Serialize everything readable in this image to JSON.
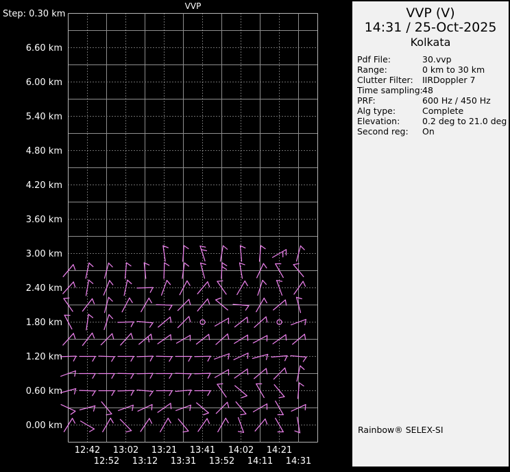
{
  "plot": {
    "title": "VVP",
    "step_label": "Step: 0.30 km"
  },
  "panel": {
    "title": "VVP (V)",
    "datetime": "14:31 / 25-Oct-2025",
    "site": "Kolkata",
    "fields": [
      {
        "label": "Pdf File:",
        "value": "30.vvp"
      },
      {
        "label": "Range:",
        "value": "0 km to 30 km"
      },
      {
        "label": "Clutter Filter:",
        "value": "IIRDoppler 7"
      },
      {
        "label": "Time sampling:",
        "value": "48"
      },
      {
        "label": "PRF:",
        "value": "600 Hz / 450 Hz"
      },
      {
        "label": "Alg type:",
        "value": "Complete"
      },
      {
        "label": "Elevation:",
        "value": "0.2 deg to 21.0 deg"
      },
      {
        "label": "Second reg:",
        "value": "On"
      }
    ],
    "branding": "Rainbow® SELEX-SI"
  },
  "chart_data": {
    "type": "wind-barb-time-height",
    "title": "VVP",
    "step_km": 0.3,
    "height_range_km": [
      0.0,
      7.2
    ],
    "grid": "solid-and-dotted-alternating",
    "y_tick_labels": [
      "6.60 km",
      "6.00 km",
      "5.40 km",
      "4.80 km",
      "4.20 km",
      "3.60 km",
      "3.00 km",
      "2.40 km",
      "1.80 km",
      "1.20 km",
      "0.60 km",
      "0.00 km"
    ],
    "y_tick_values_km": [
      6.6,
      6.0,
      5.4,
      4.8,
      4.2,
      3.6,
      3.0,
      2.4,
      1.8,
      1.2,
      0.6,
      0.0
    ],
    "x_tick_labels": [
      "12:42",
      "12:52",
      "13:02",
      "13:12",
      "13:21",
      "13:31",
      "13:41",
      "13:52",
      "14:02",
      "14:11",
      "14:21",
      "14:31"
    ],
    "x_label_stagger": "odd-ticks-upper-row,even-ticks-lower-row",
    "columns": 13,
    "labeled_ticks_start_col": 1,
    "colors": {
      "background": "#000000",
      "barb": "#ee82ee",
      "grid_solid": "#8f8f8f",
      "grid_dotted": "#dcdcdc",
      "frame": "#b8b8b8",
      "text": "#ffffff",
      "panel_bg": "#f1f1f1",
      "panel_text": "#000000"
    },
    "calm_points": [
      {
        "height_km": 1.8,
        "col": 7
      },
      {
        "height_km": 1.8,
        "col": 11
      }
    ],
    "barbs_format": [
      "height_km",
      "col",
      "staff_angle_deg_cw_from_up",
      "feathers"
    ],
    "barbs": [
      [
        3.0,
        5,
        -8,
        1
      ],
      [
        3.0,
        6,
        4,
        1
      ],
      [
        3.0,
        7,
        -18,
        2
      ],
      [
        3.0,
        8,
        10,
        1
      ],
      [
        3.0,
        9,
        -5,
        1
      ],
      [
        3.0,
        10,
        5,
        1
      ],
      [
        3.0,
        11,
        60,
        2
      ],
      [
        3.0,
        12,
        15,
        1
      ],
      [
        2.7,
        0,
        40,
        1
      ],
      [
        2.7,
        1,
        12,
        1
      ],
      [
        2.7,
        2,
        15,
        1
      ],
      [
        2.7,
        3,
        5,
        1
      ],
      [
        2.7,
        4,
        -6,
        1
      ],
      [
        2.7,
        5,
        2,
        1
      ],
      [
        2.7,
        6,
        8,
        1
      ],
      [
        2.7,
        7,
        -15,
        1
      ],
      [
        2.7,
        8,
        3,
        2
      ],
      [
        2.7,
        9,
        -10,
        1
      ],
      [
        2.7,
        10,
        25,
        1
      ],
      [
        2.7,
        11,
        -30,
        1
      ],
      [
        2.7,
        12,
        -40,
        1
      ],
      [
        2.4,
        0,
        42,
        1
      ],
      [
        2.4,
        1,
        10,
        1
      ],
      [
        2.4,
        2,
        22,
        1
      ],
      [
        2.4,
        3,
        12,
        1
      ],
      [
        2.4,
        4,
        88,
        1
      ],
      [
        2.4,
        5,
        20,
        1
      ],
      [
        2.4,
        6,
        28,
        1
      ],
      [
        2.4,
        7,
        40,
        1
      ],
      [
        2.4,
        8,
        -35,
        1
      ],
      [
        2.4,
        9,
        30,
        1
      ],
      [
        2.4,
        10,
        18,
        1
      ],
      [
        2.4,
        11,
        -20,
        1
      ],
      [
        2.4,
        12,
        35,
        1
      ],
      [
        2.1,
        0,
        -35,
        1
      ],
      [
        2.1,
        1,
        38,
        1
      ],
      [
        2.1,
        2,
        15,
        1
      ],
      [
        2.1,
        3,
        28,
        1
      ],
      [
        2.1,
        4,
        30,
        1
      ],
      [
        2.1,
        5,
        92,
        1
      ],
      [
        2.1,
        6,
        45,
        1
      ],
      [
        2.1,
        7,
        40,
        1
      ],
      [
        2.1,
        8,
        -50,
        1
      ],
      [
        2.1,
        9,
        95,
        1
      ],
      [
        2.1,
        10,
        30,
        1
      ],
      [
        2.1,
        11,
        50,
        1
      ],
      [
        2.1,
        12,
        -15,
        1
      ],
      [
        1.8,
        0,
        -28,
        1
      ],
      [
        1.8,
        1,
        8,
        1
      ],
      [
        1.8,
        2,
        18,
        1
      ],
      [
        1.8,
        3,
        88,
        1
      ],
      [
        1.8,
        4,
        95,
        1
      ],
      [
        1.8,
        5,
        50,
        1
      ],
      [
        1.8,
        6,
        45,
        1
      ],
      [
        1.8,
        8,
        60,
        1
      ],
      [
        1.8,
        9,
        52,
        1
      ],
      [
        1.8,
        10,
        48,
        1
      ],
      [
        1.8,
        12,
        70,
        1
      ],
      [
        1.5,
        0,
        42,
        1
      ],
      [
        1.5,
        1,
        38,
        1
      ],
      [
        1.5,
        2,
        45,
        1
      ],
      [
        1.5,
        3,
        42,
        1
      ],
      [
        1.5,
        4,
        50,
        2
      ],
      [
        1.5,
        5,
        55,
        1
      ],
      [
        1.5,
        6,
        60,
        1
      ],
      [
        1.5,
        7,
        52,
        1
      ],
      [
        1.5,
        8,
        48,
        1
      ],
      [
        1.5,
        9,
        58,
        1
      ],
      [
        1.5,
        10,
        62,
        1
      ],
      [
        1.5,
        11,
        55,
        1
      ],
      [
        1.5,
        12,
        50,
        1
      ],
      [
        1.2,
        0,
        88,
        1
      ],
      [
        1.2,
        1,
        90,
        1
      ],
      [
        1.2,
        2,
        92,
        1
      ],
      [
        1.2,
        3,
        90,
        1
      ],
      [
        1.2,
        4,
        88,
        1
      ],
      [
        1.2,
        5,
        91,
        1
      ],
      [
        1.2,
        6,
        90,
        1
      ],
      [
        1.2,
        7,
        89,
        1
      ],
      [
        1.2,
        8,
        70,
        1
      ],
      [
        1.2,
        9,
        65,
        1
      ],
      [
        1.2,
        10,
        75,
        1
      ],
      [
        1.2,
        11,
        85,
        1
      ],
      [
        1.2,
        12,
        95,
        1
      ],
      [
        0.9,
        0,
        70,
        1
      ],
      [
        0.9,
        1,
        90,
        1
      ],
      [
        0.9,
        2,
        90,
        1
      ],
      [
        0.9,
        3,
        91,
        1
      ],
      [
        0.9,
        4,
        89,
        1
      ],
      [
        0.9,
        5,
        90,
        1
      ],
      [
        0.9,
        6,
        92,
        1
      ],
      [
        0.9,
        7,
        88,
        1
      ],
      [
        0.9,
        8,
        60,
        1
      ],
      [
        0.9,
        9,
        55,
        1
      ],
      [
        0.9,
        10,
        50,
        1
      ],
      [
        0.9,
        11,
        45,
        1
      ],
      [
        0.9,
        12,
        12,
        1
      ],
      [
        0.6,
        0,
        75,
        1
      ],
      [
        0.6,
        1,
        92,
        1
      ],
      [
        0.6,
        2,
        90,
        1
      ],
      [
        0.6,
        3,
        88,
        1
      ],
      [
        0.6,
        4,
        95,
        1
      ],
      [
        0.6,
        5,
        90,
        1
      ],
      [
        0.6,
        6,
        85,
        1
      ],
      [
        0.6,
        7,
        90,
        1
      ],
      [
        0.6,
        8,
        -35,
        1
      ],
      [
        0.6,
        9,
        130,
        1
      ],
      [
        0.6,
        10,
        -30,
        1
      ],
      [
        0.6,
        11,
        140,
        1
      ],
      [
        0.6,
        12,
        5,
        1
      ],
      [
        0.3,
        0,
        115,
        1
      ],
      [
        0.3,
        1,
        75,
        1
      ],
      [
        0.3,
        2,
        140,
        1
      ],
      [
        0.3,
        3,
        70,
        1
      ],
      [
        0.3,
        4,
        65,
        1
      ],
      [
        0.3,
        5,
        55,
        1
      ],
      [
        0.3,
        6,
        70,
        1
      ],
      [
        0.3,
        7,
        130,
        1
      ],
      [
        0.3,
        8,
        45,
        1
      ],
      [
        0.3,
        9,
        140,
        1
      ],
      [
        0.3,
        10,
        60,
        1
      ],
      [
        0.3,
        11,
        150,
        1
      ],
      [
        0.3,
        12,
        65,
        1
      ],
      [
        0.0,
        0,
        32,
        1
      ],
      [
        0.0,
        1,
        120,
        1
      ],
      [
        0.0,
        2,
        30,
        1
      ],
      [
        0.0,
        3,
        135,
        1
      ],
      [
        0.0,
        4,
        34,
        1
      ],
      [
        0.0,
        5,
        30,
        1
      ],
      [
        0.0,
        6,
        140,
        1
      ],
      [
        0.0,
        7,
        35,
        1
      ],
      [
        0.0,
        8,
        30,
        1
      ],
      [
        0.0,
        9,
        160,
        1
      ],
      [
        0.0,
        10,
        40,
        1
      ],
      [
        0.0,
        11,
        150,
        1
      ],
      [
        0.0,
        12,
        170,
        1
      ]
    ]
  }
}
